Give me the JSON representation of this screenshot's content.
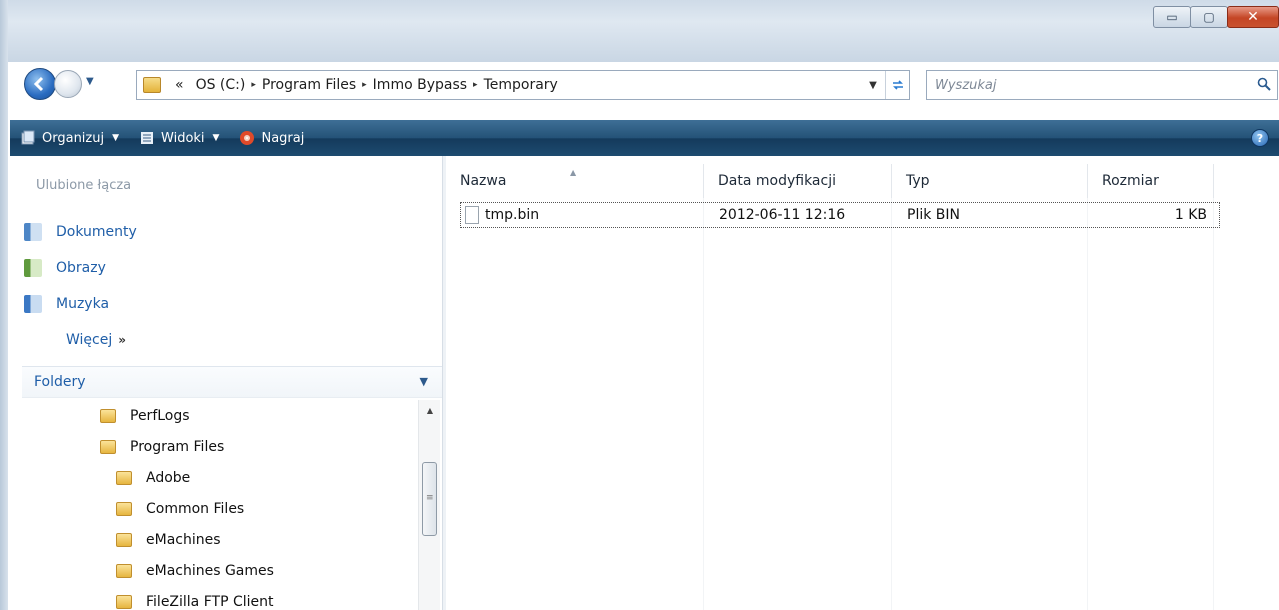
{
  "window": {
    "controls": {
      "minimize_glyph": "▭",
      "maximize_glyph": "▢",
      "close_glyph": "✕"
    }
  },
  "address": {
    "prefix": "«",
    "crumbs": [
      "OS (C:)",
      "Program Files",
      "Immo Bypass",
      "Temporary"
    ],
    "separator": "▸"
  },
  "search": {
    "placeholder": "Wyszukaj"
  },
  "toolbar": {
    "organize_label": "Organizuj",
    "views_label": "Widoki",
    "burn_label": "Nagraj",
    "help_label": "?"
  },
  "favorites": {
    "heading": "Ulubione łącza",
    "items": [
      {
        "label": "Dokumenty",
        "icon": "documents-icon",
        "color": "#4d86c6"
      },
      {
        "label": "Obrazy",
        "icon": "pictures-icon",
        "color": "#5f9a3d"
      },
      {
        "label": "Muzyka",
        "icon": "music-icon",
        "color": "#3b78c4"
      }
    ],
    "more_label": "Więcej",
    "more_arrow": "»"
  },
  "folders": {
    "heading": "Foldery",
    "tree": [
      {
        "label": "PerfLogs",
        "level": 1
      },
      {
        "label": "Program Files",
        "level": 1
      },
      {
        "label": "Adobe",
        "level": 2
      },
      {
        "label": "Common Files",
        "level": 2
      },
      {
        "label": "eMachines",
        "level": 2
      },
      {
        "label": "eMachines Games",
        "level": 2
      },
      {
        "label": "FileZilla FTP Client",
        "level": 2
      }
    ]
  },
  "filelist": {
    "columns": [
      "Nazwa",
      "Data modyfikacji",
      "Typ",
      "Rozmiar"
    ],
    "rows": [
      {
        "name": "tmp.bin",
        "date": "2012-06-11 12:16",
        "type": "Plik BIN",
        "size": "1 KB"
      }
    ]
  },
  "colors": {
    "link_blue": "#1f5ea8",
    "commandbar": "#245277"
  }
}
